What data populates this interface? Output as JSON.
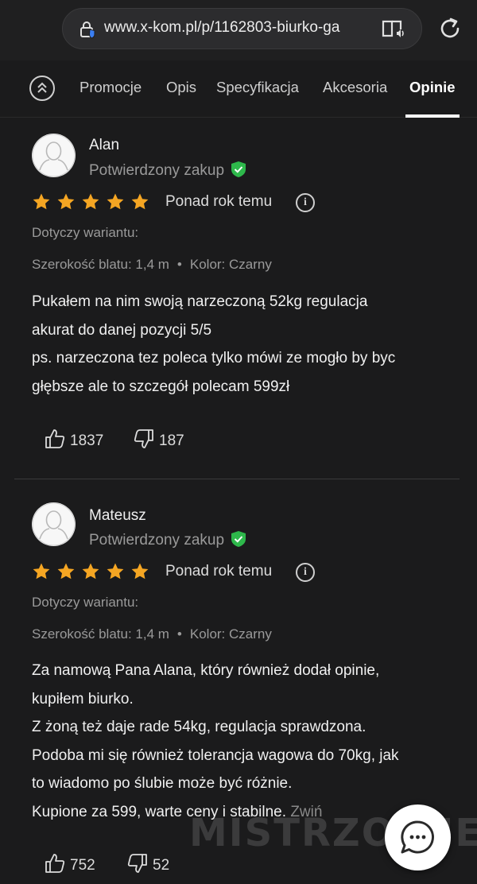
{
  "browser": {
    "url": "www.x-kom.pl/p/1162803-biurko-ga"
  },
  "tabs": [
    {
      "label": "Promocje"
    },
    {
      "label": "Opis"
    },
    {
      "label": "Specyfikacja"
    },
    {
      "label": "Akcesoria"
    },
    {
      "label": "Opinie",
      "active": true
    }
  ],
  "reviews": [
    {
      "author": "Alan",
      "verified": "Potwierdzony zakup",
      "rating": 5,
      "rating_max": 5,
      "when": "Ponad rok temu",
      "variant_label": "Dotyczy wariantu:",
      "variant_width": "Szerokość blatu: 1,4 m",
      "variant_color": "Kolor: Czarny",
      "body": [
        "Pukałem na nim swoją narzeczoną 52kg regulacja",
        "akurat do danej pozycji 5/5",
        "ps. narzeczona tez poleca tylko mówi ze mogło by byc",
        "głębsze ale to szczegół polecam 599zł"
      ],
      "likes": "1837",
      "dislikes": "187"
    },
    {
      "author": "Mateusz",
      "verified": "Potwierdzony zakup",
      "rating": 5,
      "rating_max": 5,
      "when": "Ponad rok temu",
      "variant_label": "Dotyczy wariantu:",
      "variant_width": "Szerokość blatu: 1,4 m",
      "variant_color": "Kolor: Czarny",
      "body": [
        "Za namową Pana Alana, który również dodał opinie,",
        "kupiłem biurko.",
        "Z żoną też daje rade 54kg, regulacja sprawdzona.",
        "Podoba mi się również tolerancja wagowa do 70kg, jak",
        "to wiadomo po ślubie może być różnie.",
        "Kupione za 599, warte ceny i stabilne."
      ],
      "collapse_label": "Zwiń",
      "likes": "752",
      "dislikes": "52"
    }
  ],
  "watermark": "MISTRZOWIE.ORG",
  "icons": {
    "lock": "lock-shield-icon",
    "reader": "reader-mode-icon",
    "reload": "reload-icon",
    "collapse": "chevrons-up-icon",
    "verified": "verified-shield-icon",
    "star": "star-icon",
    "info": "info-icon",
    "like": "thumb-up-icon",
    "dislike": "thumb-down-icon",
    "chat": "chat-bubble-icon"
  },
  "colors": {
    "background": "#1b1b1c",
    "star": "#f5a623",
    "verified": "#2eb84b",
    "text_muted": "#9a9a9a"
  }
}
